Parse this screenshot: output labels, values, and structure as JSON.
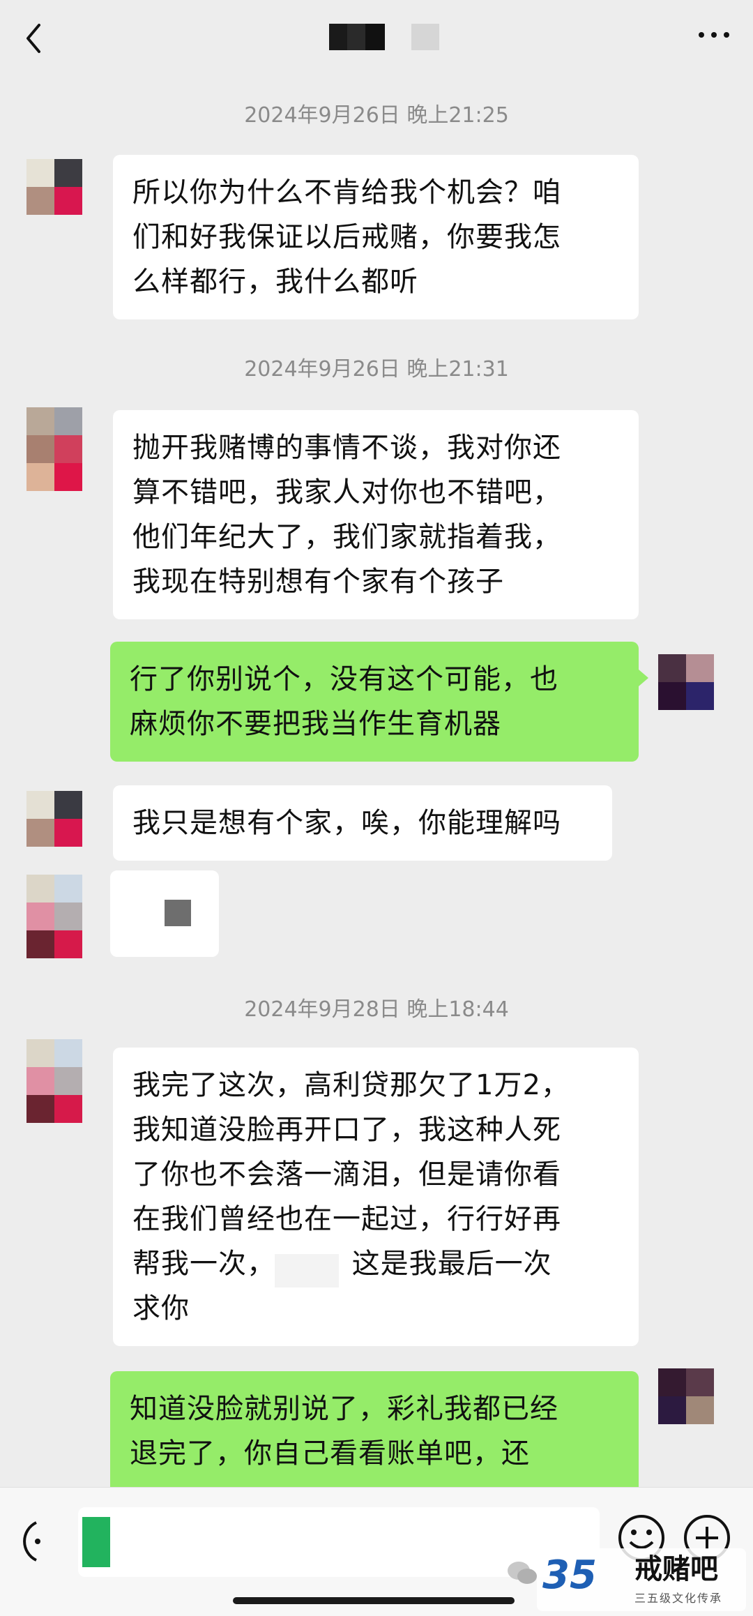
{
  "messages": [
    {
      "type": "timestamp",
      "text": "2024年9月26日 晚上21:25"
    },
    {
      "type": "received",
      "text": "所以你为什么不肯给我个机会？咱\n们和好我保证以后戒赌，你要我怎\n么样都行，我什么都听"
    },
    {
      "type": "timestamp",
      "text": "2024年9月26日 晚上21:31"
    },
    {
      "type": "received",
      "text": "抛开我赌博的事情不谈，我对你还\n算不错吧，我家人对你也不错吧，\n他们年纪大了，我们家就指着我，\n我现在特别想有个家有个孩子"
    },
    {
      "type": "sent",
      "text": "行了你别说个，没有这个可能，也\n麻烦你不要把我当作生育机器"
    },
    {
      "type": "received",
      "text": "我只是想有个家，唉，你能理解吗"
    },
    {
      "type": "received-image",
      "text": ""
    },
    {
      "type": "timestamp",
      "text": "2024年9月28日 晚上18:44"
    },
    {
      "type": "received",
      "text": "我完了这次，高利贷那欠了1万2，\n我知道没脸再开口了，我这种人死\n了你也不会落一滴泪，但是请你看\n在我们曾经也在一起过，行行好再\n帮我一次，     、这是我最后一次\n求你"
    },
    {
      "type": "sent",
      "text": "知道没脸就别说了，彩礼我都已经\n退完了，你自己看看账单吧，还"
    }
  ],
  "watermark": {
    "logo": "35",
    "title": "戒赌吧",
    "subtitle": "三五级文化传承"
  },
  "colors": {
    "background": "#ededed",
    "sent_bubble": "#95ec69",
    "received_bubble": "#ffffff",
    "timestamp": "#8a8a8a"
  },
  "icons": {
    "back": "chevron-left-icon",
    "more": "more-dots-icon",
    "voice": "voice-icon",
    "emoji": "emoji-icon",
    "plus": "plus-icon"
  }
}
